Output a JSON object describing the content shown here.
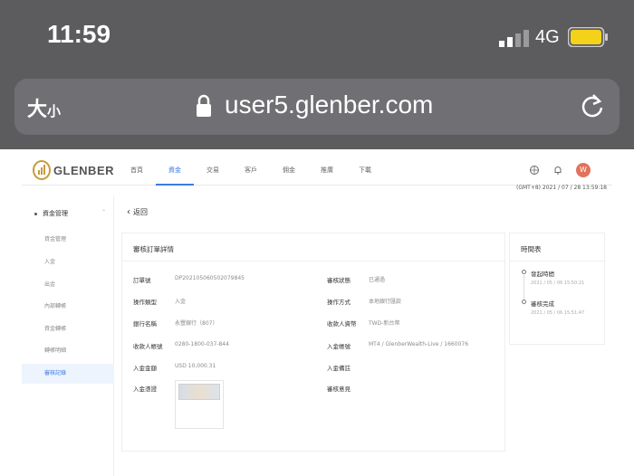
{
  "status_bar": {
    "time": "11:59",
    "network": "4G"
  },
  "browser": {
    "text_size": "大",
    "text_size_small": "小",
    "url": "user5.glenber.com"
  },
  "nav": {
    "logo": "GLENBER",
    "items": [
      {
        "label": "首頁",
        "active": false
      },
      {
        "label": "資金",
        "active": true
      },
      {
        "label": "交易",
        "active": false
      },
      {
        "label": "客戶",
        "active": false
      },
      {
        "label": "佣金",
        "active": false
      },
      {
        "label": "推廣",
        "active": false
      },
      {
        "label": "下載",
        "active": false
      }
    ],
    "avatar": "W"
  },
  "timestamp": "(GMT+8) 2021 / 07 / 28 13:59:18",
  "sidebar": {
    "group": "資金管理",
    "items": [
      {
        "label": "資金管理",
        "active": false
      },
      {
        "label": "入金",
        "active": false
      },
      {
        "label": "出金",
        "active": false
      },
      {
        "label": "內部轉帳",
        "active": false
      },
      {
        "label": "資金轉帳",
        "active": false
      },
      {
        "label": "轉帳明細",
        "active": false
      },
      {
        "label": "審核記錄",
        "active": true
      }
    ]
  },
  "back": "返回",
  "detail": {
    "title": "審核訂單詳情",
    "fields": {
      "order_no_label": "訂單號",
      "order_no": "DP20210506050207984​5",
      "status_label": "審核狀態",
      "status": "已通過",
      "op_type_label": "操作類型",
      "op_type": "入金",
      "op_method_label": "操作方式",
      "op_method": "本地銀行匯款",
      "bank_label": "銀行名稱",
      "bank": "永豐銀行（807）",
      "payee_label": "收款人資幣",
      "payee": "TWD-新台幣",
      "payee_acct_label": "收款人帳號",
      "payee_acct": "0280-1800-037-844",
      "deposit_acct_label": "入金帳號",
      "deposit_acct": "MT4 / GlenberWealth-Live / 1660076",
      "amount_label": "入金金額",
      "amount": "USD 10,000.31",
      "remark_label": "入金備註",
      "remark": "",
      "receipt_label": "入金憑證",
      "opinion_label": "審核意見",
      "opinion": ""
    }
  },
  "timeline": {
    "title": "時間表",
    "events": [
      {
        "label": "發起時間",
        "time": "2021 / 05 / 06 15:50:21"
      },
      {
        "label": "審核完成",
        "time": "2021 / 05 / 06 15:51:47"
      }
    ]
  },
  "colors": {
    "accent": "#3a7be0",
    "battery": "#f5d21a",
    "brand_gold": "#c79a3b"
  }
}
